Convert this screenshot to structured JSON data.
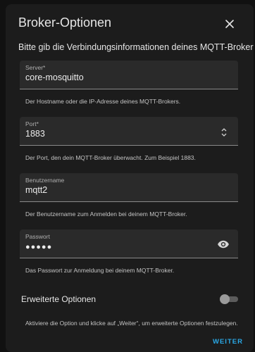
{
  "dialog": {
    "title": "Broker-Optionen",
    "intro": "Bitte gib die Verbindungsinformationen deines MQTT-Brokers ein."
  },
  "fields": {
    "server": {
      "label": "Server*",
      "value": "core-mosquitto",
      "helper": "Der Hostname oder die IP-Adresse deines MQTT-Brokers."
    },
    "port": {
      "label": "Port*",
      "value": "1883",
      "helper": "Der Port, den dein MQTT-Broker überwacht. Zum Beispiel 1883."
    },
    "username": {
      "label": "Benutzername",
      "value": "mqtt2",
      "helper": "Der Benutzername zum Anmelden bei deinem MQTT-Broker."
    },
    "password": {
      "label": "Passwort",
      "value": "●●●●●",
      "helper": "Das Passwort zur Anmeldung bei deinem MQTT-Broker."
    }
  },
  "advanced": {
    "label": "Erweiterte Optionen",
    "enabled": false,
    "helper": "Aktiviere die Option und klicke auf „Weiter“, um erweiterte Optionen festzulegen."
  },
  "actions": {
    "next_label": "WEITER"
  },
  "colors": {
    "accent": "#2aa8e6",
    "dialog_bg": "#1c1c1c",
    "field_bg": "#2a2a2a"
  },
  "icons": {
    "close": "close-icon",
    "spinner": "spinner-arrows-icon",
    "visibility": "eye-icon"
  }
}
